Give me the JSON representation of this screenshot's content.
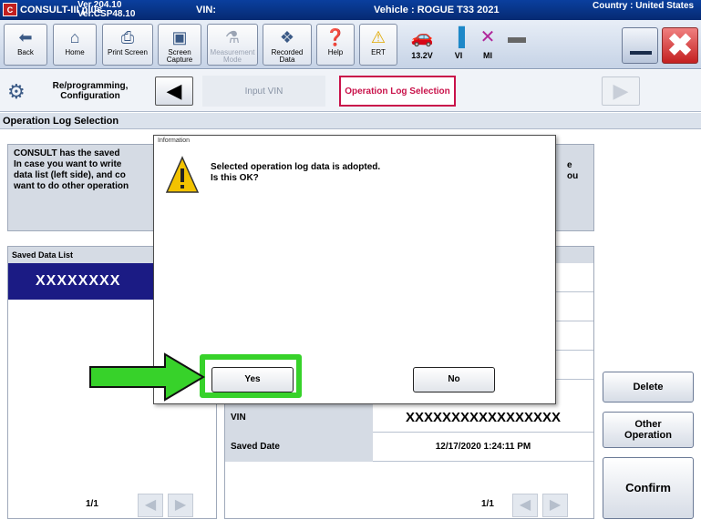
{
  "titlebar": {
    "logo": "C",
    "app_name": "CONSULT-III plus",
    "version_line1": "Ver.204.10",
    "version_line2": "Ver.CSP48.10",
    "vin_label": "VIN:",
    "vehicle": "Vehicle : ROGUE T33 2021",
    "country": "Country : United States"
  },
  "toolbar": {
    "back": "Back",
    "home": "Home",
    "print_screen": "Print Screen",
    "screen_capture": "Screen Capture",
    "measurement_mode": "Measurement Mode",
    "recorded_data": "Recorded Data",
    "help": "Help",
    "ert": "ERT",
    "voltage": "13.2V",
    "vi": "VI",
    "mi": "MI"
  },
  "nav": {
    "reprogramming": "Re/programming, Configuration",
    "step_input_vin": "Input VIN",
    "step_operation_log": "Operation Log Selection"
  },
  "section_title": "Operation Log Selection",
  "info": {
    "line1": "CONSULT has the saved",
    "line2": "In case you want to write",
    "line3": "data list (left side), and co",
    "line4": "want to do other operation",
    "right1": "e",
    "right2": "ou"
  },
  "saved_list": {
    "header": "Saved Data List",
    "selected_item": "XXXXXXXX",
    "page": "1/1"
  },
  "detail": {
    "vin_label": "VIN",
    "vin_value": "XXXXXXXXXXXXXXXXX",
    "saved_date_label": "Saved Date",
    "saved_date_value": "12/17/2020 1:24:11 PM",
    "page": "1/1"
  },
  "buttons": {
    "delete": "Delete",
    "other_operation": "Other Operation",
    "confirm": "Confirm"
  },
  "dialog": {
    "title": "Information",
    "message_line1": "Selected operation log data is adopted.",
    "message_line2": "Is this OK?",
    "yes": "Yes",
    "no": "No"
  },
  "colors": {
    "titlebar": "#062a72",
    "active_step": "#c9124a",
    "selected_row": "#1b1b84",
    "highlight": "#37d22a",
    "arrow": "#37d22a"
  }
}
